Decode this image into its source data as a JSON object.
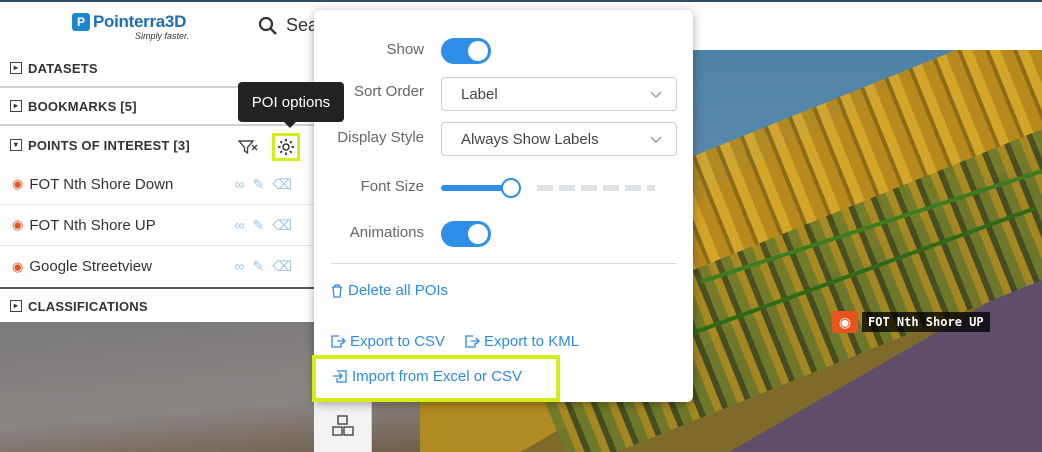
{
  "header": {
    "brand_name": "Pointerra3D",
    "brand_tagline": "Simply faster.",
    "search_text": "Sea"
  },
  "sidebar": {
    "datasets": "DATASETS",
    "bookmarks": "BOOKMARKS [5]",
    "poi_header": "POINTS OF INTEREST [3]",
    "classifications": "CLASSIFICATIONS",
    "poi_items": [
      {
        "label": "FOT Nth Shore Down"
      },
      {
        "label": "FOT Nth Shore UP"
      },
      {
        "label": "Google Streetview"
      }
    ]
  },
  "tooltip": {
    "text": "POI options"
  },
  "options": {
    "show_label": "Show",
    "show_value": true,
    "sort_label": "Sort Order",
    "sort_value": "Label",
    "display_label": "Display Style",
    "display_value": "Always Show Labels",
    "font_label": "Font Size",
    "font_size_fraction": 0.33,
    "anim_label": "Animations",
    "anim_value": true,
    "delete_all": "Delete all POIs",
    "export_csv": "Export to CSV",
    "export_kml": "Export to KML",
    "import": "Import from Excel or CSV"
  },
  "viewport": {
    "poi_marker_label": "FOT Nth Shore UP"
  },
  "colors": {
    "accent": "#2f8ee5",
    "highlight": "#d6ec16",
    "poi_orange": "#e8521c",
    "brand_blue": "#1d6fb3"
  }
}
